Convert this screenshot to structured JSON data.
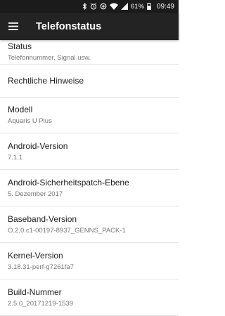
{
  "status_bar": {
    "battery": "61%",
    "time": "09:49",
    "icons": [
      "bluetooth-icon",
      "alarm-icon",
      "data-saver-icon",
      "wifi-icon",
      "signal-icon",
      "battery-icon"
    ]
  },
  "app_bar": {
    "title": "Telefonstatus",
    "menu_icon": "menu-icon"
  },
  "items": [
    {
      "title": "Status",
      "subtitle": "Telefonnummer, Signal usw."
    },
    {
      "title": "Rechtliche Hinweise",
      "subtitle": ""
    },
    {
      "title": "Modell",
      "subtitle": "Aquaris U Plus"
    },
    {
      "title": "Android-Version",
      "subtitle": "7.1.1"
    },
    {
      "title": "Android-Sicherheitspatch-Ebene",
      "subtitle": "5. Dezember 2017"
    },
    {
      "title": "Baseband-Version",
      "subtitle": "O.2.0.c1-00197-8937_GENNS_PACK-1"
    },
    {
      "title": "Kernel-Version",
      "subtitle": "3.18.31-perf-g7261fa7"
    },
    {
      "title": "Build-Nummer",
      "subtitle": "2.5.0_20171219-1539"
    }
  ]
}
